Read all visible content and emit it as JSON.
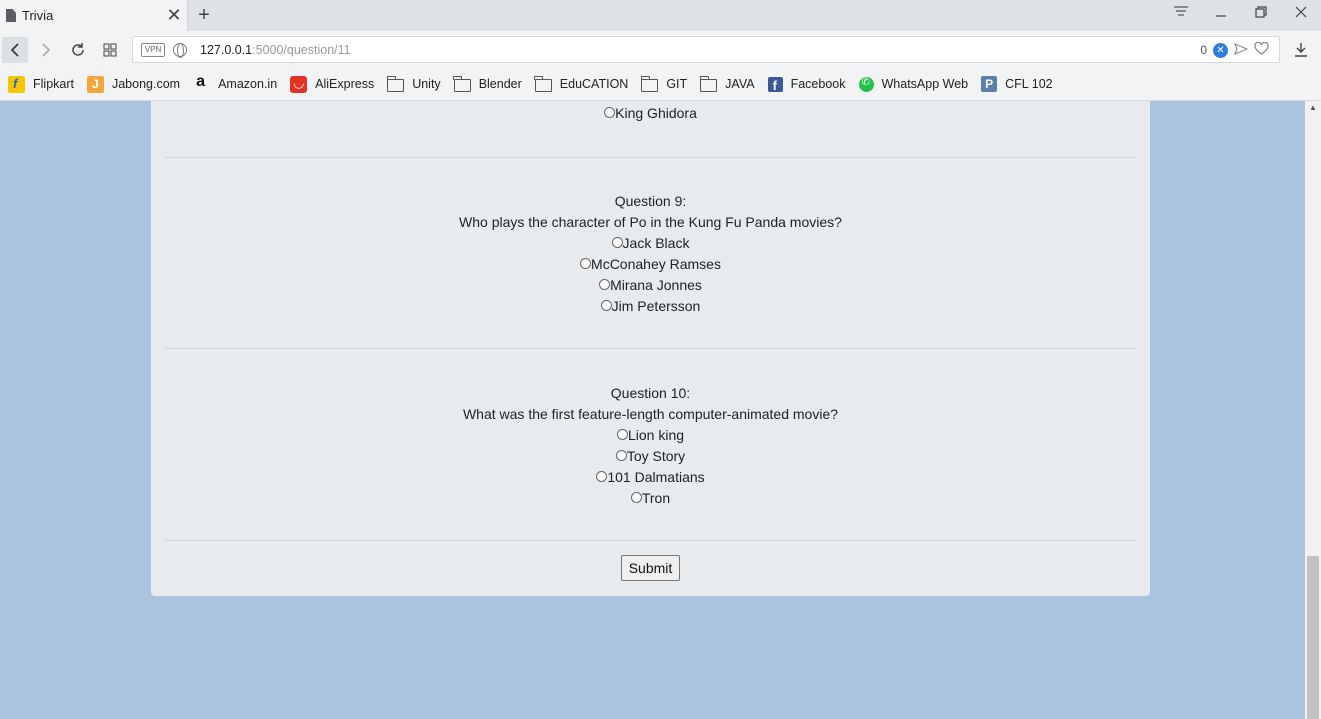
{
  "browser": {
    "tab_title": "Trivia",
    "tab_close": "✕",
    "new_tab": "+",
    "url_host": "127.0.0.1",
    "url_rest": ":5000/question/11",
    "vpn_label": "VPN",
    "badge_count": "0",
    "badge_x": "✕"
  },
  "bookmarks": [
    {
      "label": "Flipkart",
      "icon": "flipkart-icon"
    },
    {
      "label": "Jabong.com",
      "icon": "jabong-icon"
    },
    {
      "label": "Amazon.in",
      "icon": "amazon-icon"
    },
    {
      "label": "AliExpress",
      "icon": "aliexpress-icon"
    },
    {
      "label": "Unity",
      "icon": "folder-icon"
    },
    {
      "label": "Blender",
      "icon": "folder-icon"
    },
    {
      "label": "EduCATION",
      "icon": "folder-icon"
    },
    {
      "label": "GIT",
      "icon": "folder-icon"
    },
    {
      "label": "JAVA",
      "icon": "folder-icon"
    },
    {
      "label": "Facebook",
      "icon": "facebook-icon"
    },
    {
      "label": "WhatsApp Web",
      "icon": "whatsapp-icon"
    },
    {
      "label": "CFL 102",
      "icon": "p-icon"
    }
  ],
  "quiz": {
    "prev_option": "King Ghidora",
    "questions": [
      {
        "label": "Question 9:",
        "text": "Who plays the character of Po in the Kung Fu Panda movies?",
        "options": [
          "Jack Black",
          "McConahey Ramses",
          "Mirana Jonnes",
          "Jim Petersson"
        ]
      },
      {
        "label": "Question 10:",
        "text": "What was the first feature-length computer-animated movie?",
        "options": [
          "Lion king",
          "Toy Story",
          "101 Dalmatians",
          "Tron"
        ]
      }
    ],
    "submit_label": "Submit"
  }
}
